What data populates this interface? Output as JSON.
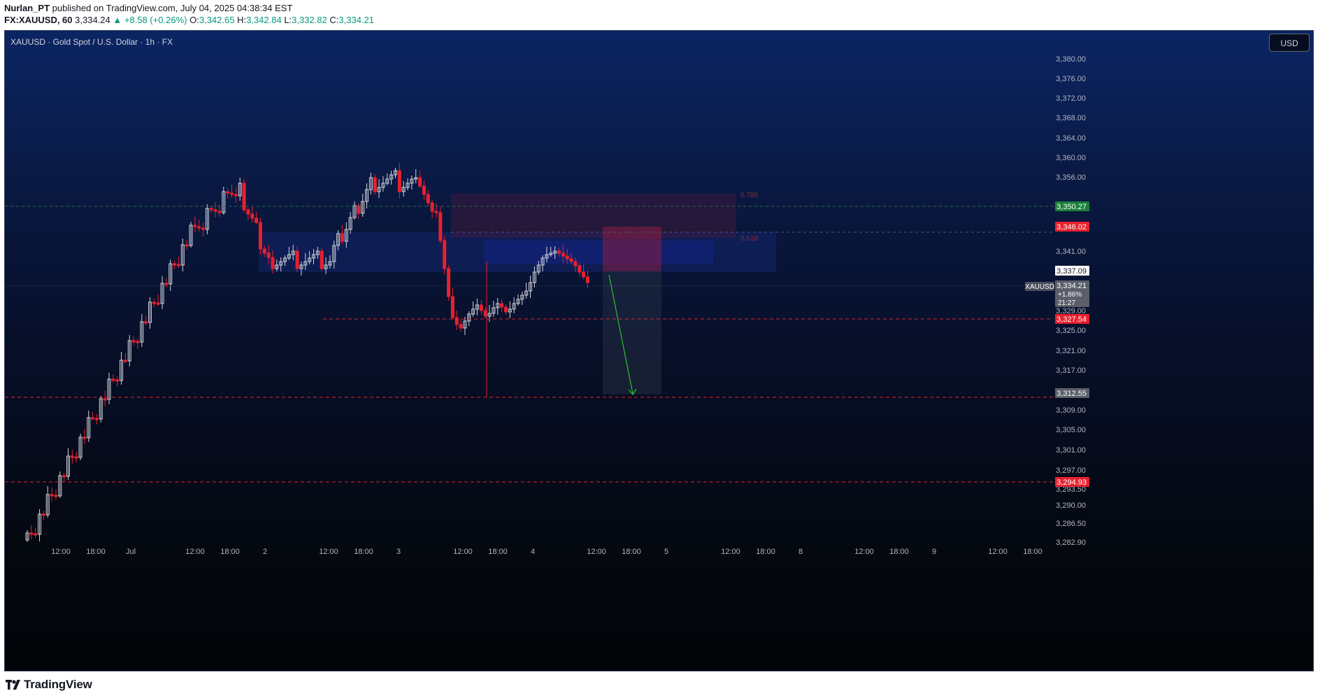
{
  "header": {
    "author": "Nurlan_PT",
    "published_text": "published on TradingView.com, July 04, 2025 04:38:34 EST",
    "symbol": "FX:XAUUSD, 60",
    "last": "3,334.24",
    "change": "▲ +8.58 (+0.26%)",
    "open_label": "O:",
    "open": "3,342.65",
    "high_label": "H:",
    "high": "3,342.84",
    "low_label": "L:",
    "low": "3,332.82",
    "close_label": "C:",
    "close": "3,334.21"
  },
  "chart": {
    "title": "XAUUSD · Gold Spot / U.S. Dollar · 1h · FX",
    "currency_button": "USD",
    "price_axis": [
      "3,380.00",
      "3,376.00",
      "3,372.00",
      "3,368.00",
      "3,364.00",
      "3,360.00",
      "3,356.00",
      "3,341.00",
      "3,329.00",
      "3,325.00",
      "3,321.00",
      "3,317.00",
      "3,309.00",
      "3,305.00",
      "3,301.00",
      "3,297.00",
      "3,293.50",
      "3,290.00",
      "3,286.50",
      "3,282.90"
    ],
    "time_axis": [
      "12:00",
      "18:00",
      "Jul",
      "12:00",
      "18:00",
      "2",
      "12:00",
      "18:00",
      "3",
      "12:00",
      "18:00",
      "4",
      "12:00",
      "18:00",
      "5",
      "12:00",
      "18:00",
      "8",
      "12:00",
      "18:00",
      "9",
      "12:00",
      "18:00"
    ],
    "price_labels": [
      {
        "text": "3,350.27",
        "color": "#1b7f3a"
      },
      {
        "text": "3,346.02",
        "color": "#e8202e"
      },
      {
        "text": "3,337.09",
        "color": "#ffffff"
      },
      {
        "text": "3,327.54",
        "color": "#e8202e"
      },
      {
        "text": "3,312.55",
        "color": "#5a5f6a"
      },
      {
        "text": "3,294.93",
        "color": "#e8202e"
      }
    ],
    "current_price": {
      "symbol": "XAUUSD",
      "price": "3,334.21",
      "change": "+1.86%",
      "countdown": "21:27"
    },
    "fib_labels": [
      "0.786",
      "0.618"
    ],
    "candle_colors": {
      "up": "#d1d4dc",
      "down": "#e8202e"
    }
  },
  "footer": {
    "logo": "TradingView"
  }
}
